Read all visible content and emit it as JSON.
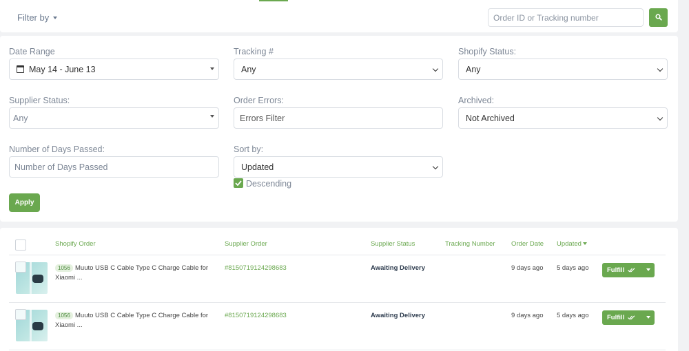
{
  "topbar": {
    "filter_by_label": "Filter by",
    "search_placeholder": "Order ID or Tracking number"
  },
  "filters": {
    "date_range": {
      "label": "Date Range",
      "value": "May 14 - June 13"
    },
    "tracking": {
      "label": "Tracking #",
      "value": "Any"
    },
    "shopify_status": {
      "label": "Shopify Status:",
      "value": "Any"
    },
    "supplier_status": {
      "label": "Supplier Status:",
      "value": "Any"
    },
    "order_errors": {
      "label": "Order Errors:",
      "value": "Errors Filter"
    },
    "archived": {
      "label": "Archived:",
      "value": "Not Archived"
    },
    "days_passed": {
      "label": "Number of Days Passed:",
      "placeholder": "Number of Days Passed"
    },
    "sort_by": {
      "label": "Sort by:",
      "value": "Updated"
    },
    "descending": {
      "label": "Descending",
      "checked": true
    },
    "apply_label": "Apply"
  },
  "table": {
    "headers": {
      "shopify_order": "Shopify Order",
      "supplier_order": "Supplier Order",
      "supplier_status": "Supplier Status",
      "tracking_number": "Tracking Number",
      "order_date": "Order Date",
      "updated": "Updated"
    },
    "rows": [
      {
        "order_number": "1056",
        "title": "Muuto USB C Cable Type C Charge Cable for Xiaomi ...",
        "supplier_order": "#8150719124298683",
        "supplier_status": "Awaiting Delivery",
        "tracking_number": "",
        "order_date": "9 days ago",
        "updated": "5 days ago",
        "action_label": "Fulfill"
      },
      {
        "order_number": "1056",
        "title": "Muuto USB C Cable Type C Charge Cable for Xiaomi ...",
        "supplier_order": "#8150719124298683",
        "supplier_status": "Awaiting Delivery",
        "tracking_number": "",
        "order_date": "9 days ago",
        "updated": "5 days ago",
        "action_label": "Fulfill"
      }
    ]
  },
  "colors": {
    "accent": "#6aa84f",
    "background": "#f1f2f4"
  }
}
